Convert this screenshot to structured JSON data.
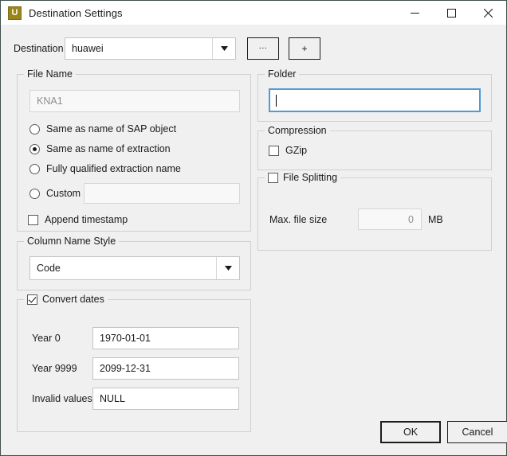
{
  "window": {
    "title": "Destination Settings",
    "icon": "app-icon-u",
    "icon_letter": "U",
    "icon_color": "#9a8518",
    "border_color": "#3f4f4c",
    "background": "#f0f0f0",
    "accent_focus": "#4f9ad8",
    "controls": {
      "minimize": "minimize-icon",
      "maximize": "maximize-icon",
      "close": "close-icon"
    }
  },
  "destination": {
    "label": "Destination",
    "value": "huawei",
    "placeholder": "",
    "dropdown_icon": "chevron-down-icon",
    "browse_button": "...",
    "add_button": "+"
  },
  "file_name": {
    "title": "File Name",
    "preview_value": "KNA1",
    "options": [
      {
        "label": "Same as name of SAP object",
        "selected": false
      },
      {
        "label": "Same as name of extraction",
        "selected": true
      },
      {
        "label": "Fully qualified extraction name",
        "selected": false
      },
      {
        "label": "Custom",
        "selected": false
      }
    ],
    "custom_value": "",
    "append_timestamp": {
      "label": "Append timestamp",
      "checked": false
    }
  },
  "column_name_style": {
    "title": "Column Name Style",
    "value": "Code",
    "dropdown_icon": "chevron-down-icon"
  },
  "convert_dates": {
    "title": "Convert dates",
    "checked": true,
    "fields": [
      {
        "label": "Year 0",
        "value": "1970-01-01"
      },
      {
        "label": "Year 9999",
        "value": "2099-12-31"
      },
      {
        "label": "Invalid values",
        "value": "NULL"
      }
    ]
  },
  "folder": {
    "title": "Folder",
    "value": "",
    "focused": true
  },
  "compression": {
    "title": "Compression",
    "gzip": {
      "label": "GZip",
      "checked": false
    }
  },
  "file_splitting": {
    "title": "File Splitting",
    "checked": false,
    "max_file_size": {
      "label": "Max. file size",
      "value": "0",
      "unit": "MB",
      "enabled": false
    }
  },
  "footer": {
    "ok_label": "OK",
    "cancel_label": "Cancel"
  }
}
